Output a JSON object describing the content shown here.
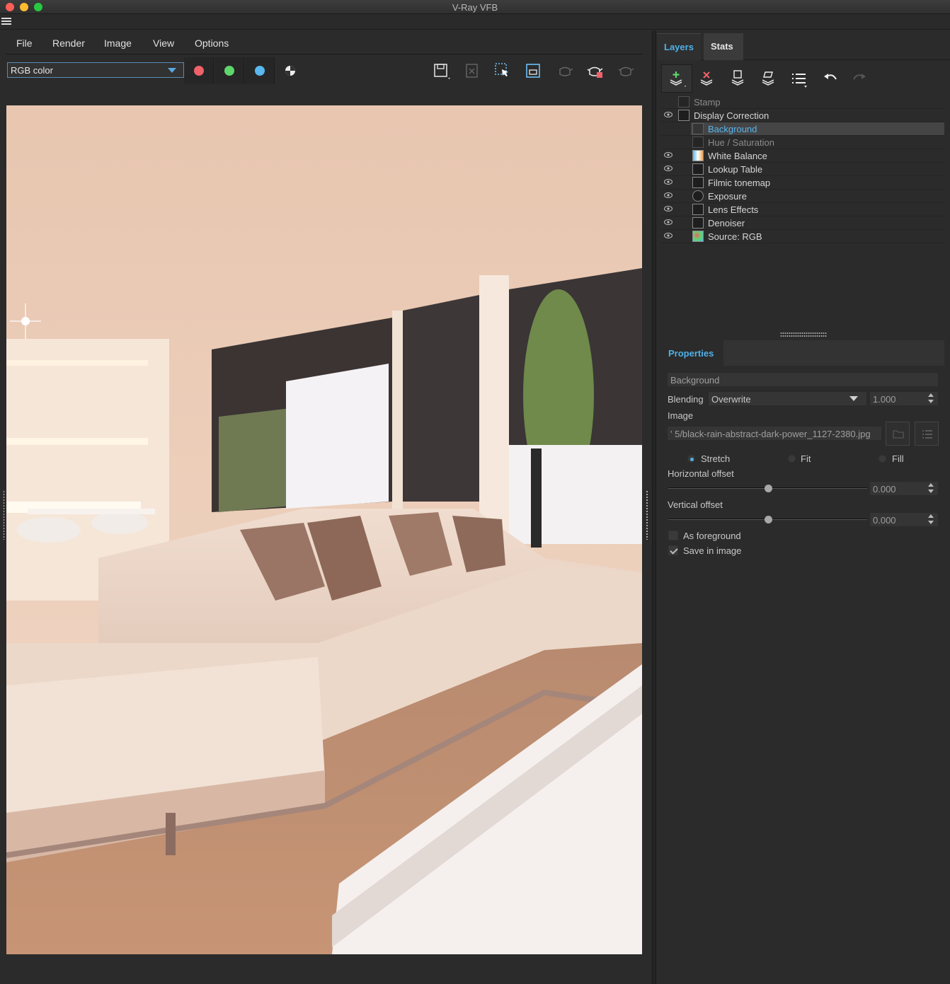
{
  "window": {
    "title": "V-Ray VFB"
  },
  "menu": [
    "File",
    "Render",
    "Image",
    "View",
    "Options"
  ],
  "toolbar": {
    "channel": "RGB color",
    "channel_dots": [
      {
        "name": "red-channel",
        "color": "#f0616a"
      },
      {
        "name": "green-channel",
        "color": "#5fd66b"
      },
      {
        "name": "blue-channel",
        "color": "#5ab7f0"
      }
    ]
  },
  "tabs": {
    "layers": "Layers",
    "stats": "Stats"
  },
  "layers": [
    {
      "label": "Stamp",
      "visible": false,
      "indent": 0,
      "dim": true,
      "icon": "stamp-icon"
    },
    {
      "label": "Display Correction",
      "visible": true,
      "indent": 0,
      "dim": false,
      "icon": "curve-icon"
    },
    {
      "label": "Background",
      "visible": false,
      "indent": 1,
      "dim": false,
      "selected": true,
      "icon": "background-icon"
    },
    {
      "label": "Hue / Saturation",
      "visible": false,
      "indent": 1,
      "dim": true,
      "icon": "hue-saturation-icon"
    },
    {
      "label": "White Balance",
      "visible": true,
      "indent": 1,
      "dim": false,
      "icon": "white-balance-icon"
    },
    {
      "label": "Lookup Table",
      "visible": true,
      "indent": 1,
      "dim": false,
      "icon": "lut-icon"
    },
    {
      "label": "Filmic tonemap",
      "visible": true,
      "indent": 1,
      "dim": false,
      "icon": "filmic-icon"
    },
    {
      "label": "Exposure",
      "visible": true,
      "indent": 1,
      "dim": false,
      "icon": "exposure-icon"
    },
    {
      "label": "Lens Effects",
      "visible": true,
      "indent": 1,
      "dim": false,
      "icon": "lens-effects-icon"
    },
    {
      "label": "Denoiser",
      "visible": true,
      "indent": 1,
      "dim": false,
      "icon": "denoiser-icon"
    },
    {
      "label": "Source: RGB",
      "visible": true,
      "indent": 1,
      "dim": false,
      "icon": "source-rgb-icon"
    }
  ],
  "properties": {
    "header": "Properties",
    "layer_name": "Background",
    "blending_label": "Blending",
    "blending_mode": "Overwrite",
    "blending_amount": "1.000",
    "image_label": "Image",
    "image_path": "' 5/black-rain-abstract-dark-power_1127-2380.jpg",
    "fit_options": [
      "Stretch",
      "Fit",
      "Fill"
    ],
    "fit_selected": "Stretch",
    "h_offset_label": "Horizontal offset",
    "h_offset_value": "0.000",
    "h_offset_position": 0.5,
    "v_offset_label": "Vertical offset",
    "v_offset_value": "0.000",
    "v_offset_position": 0.5,
    "as_foreground_label": "As foreground",
    "as_foreground": false,
    "save_in_image_label": "Save in image",
    "save_in_image": true
  }
}
